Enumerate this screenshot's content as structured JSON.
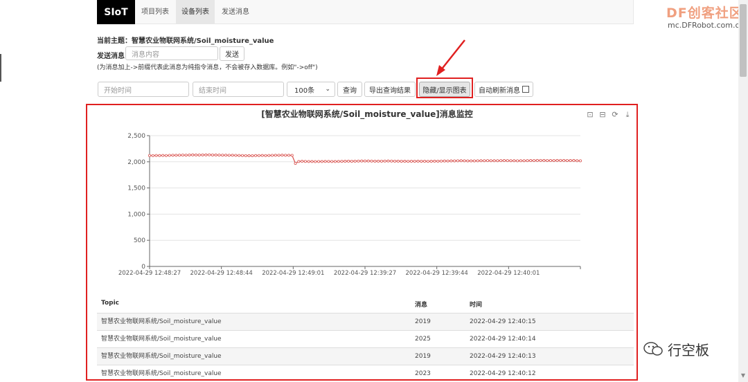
{
  "nav": {
    "brand": "SIoT",
    "links": [
      "项目列表",
      "设备列表",
      "发送消息"
    ],
    "active_index": 1
  },
  "watermark": {
    "logo": "DF创客社区",
    "url": "mc.DFRobot.com.cn",
    "wechat": "行空板"
  },
  "topic": {
    "label": "当前主题：",
    "value": "智慧农业物联网系统/Soil_moisture_value"
  },
  "send": {
    "label": "发送消息",
    "placeholder": "消息内容",
    "button": "发送",
    "hint": "(为消息加上->前缀代表此消息为纯指令消息，不会被存入数据库。例如\"->off\")"
  },
  "query": {
    "start_placeholder": "开始时间",
    "end_placeholder": "结束时间",
    "limit_value": "100条",
    "query_button": "查询",
    "export_button": "导出查询结果",
    "toggle_chart_button": "隐藏/显示图表",
    "auto_refresh_label": "自动刷新消息"
  },
  "chart_toolbar_icons": [
    "zoom-icon",
    "zoom-reset-icon",
    "restore-icon",
    "download-icon"
  ],
  "chart_data": {
    "type": "line",
    "title": "[智慧农业物联网系统/Soil_moisture_value]消息监控",
    "x_tick_labels": [
      "2022-04-29 12:48:27",
      "2022-04-29 12:48:44",
      "2022-04-29 12:49:01",
      "2022-04-29 12:39:27",
      "2022-04-29 12:39:44",
      "2022-04-29 12:40:01"
    ],
    "y_ticks": [
      0,
      500,
      1000,
      1500,
      2000,
      2500
    ],
    "y_tick_labels": [
      "0",
      "500",
      "1,000",
      "1,500",
      "2,000",
      "2,500"
    ],
    "ylim": [
      0,
      2500
    ],
    "grid": true,
    "color": "#d9534f",
    "series": [
      {
        "values": [
          2120,
          2118,
          2122,
          2119,
          2121,
          2120,
          2123,
          2125,
          2124,
          2126,
          2128,
          2127,
          2130,
          2131,
          2129,
          2130,
          2132,
          2131,
          2133,
          2130,
          2129,
          2128,
          2127,
          2126,
          2125,
          2124,
          2123,
          2122,
          2120,
          2118,
          2116,
          2117,
          2119,
          2120,
          2121,
          2120,
          2122,
          2123,
          2124,
          2125,
          2126,
          2125,
          2124,
          2123,
          1970,
          2005,
          2010,
          2008,
          2006,
          2005,
          2004,
          2006,
          2005,
          2007,
          2008,
          2006,
          2005,
          2007,
          2009,
          2010,
          2012,
          2011,
          2013,
          2014,
          2015,
          2016,
          2015,
          2014,
          2013,
          2012,
          2013,
          2014,
          2015,
          2014,
          2013,
          2012,
          2011,
          2010,
          2009,
          2010,
          2011,
          2012,
          2011,
          2010,
          2009,
          2010,
          2012,
          2013,
          2014,
          2015,
          2016,
          2017,
          2018,
          2019,
          2020,
          2019,
          2018,
          2017,
          2018,
          2019,
          2020,
          2021,
          2022,
          2021,
          2020,
          2021,
          2022,
          2023,
          2022,
          2021,
          2020,
          2019,
          2020,
          2021,
          2022,
          2023,
          2024,
          2025,
          2026,
          2025,
          2024,
          2023,
          2024,
          2025,
          2026,
          2025,
          2024,
          2023,
          2025,
          2020,
          2019
        ]
      }
    ]
  },
  "table": {
    "headers": [
      "Topic",
      "消息",
      "时间"
    ],
    "rows": [
      [
        "智慧农业物联网系统/Soil_moisture_value",
        "2019",
        "2022-04-29 12:40:15"
      ],
      [
        "智慧农业物联网系统/Soil_moisture_value",
        "2025",
        "2022-04-29 12:40:14"
      ],
      [
        "智慧农业物联网系统/Soil_moisture_value",
        "2019",
        "2022-04-29 12:40:13"
      ],
      [
        "智慧农业物联网系统/Soil_moisture_value",
        "2023",
        "2022-04-29 12:40:12"
      ]
    ]
  },
  "colors": {
    "highlight": "#e02020",
    "line": "#d9534f",
    "brand_bg": "#000000"
  }
}
